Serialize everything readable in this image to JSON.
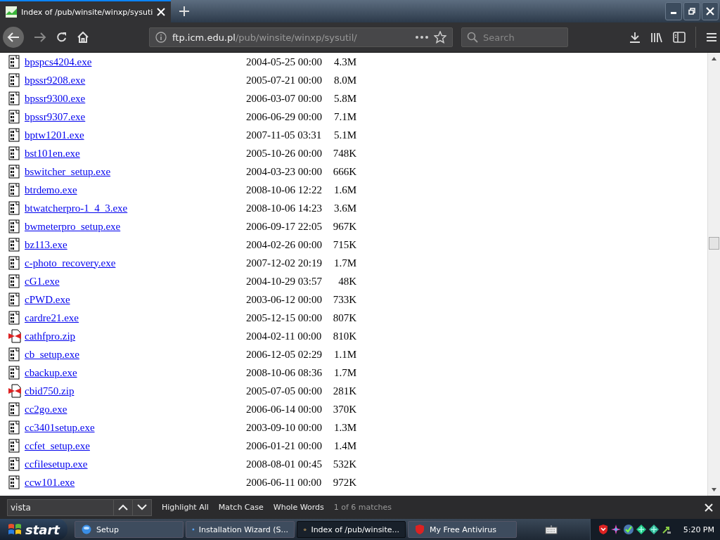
{
  "browser": {
    "tab": {
      "title": "Index of /pub/winsite/winxp/sysuti",
      "selected": true
    },
    "address": {
      "host": "ftp.icm.edu.pl",
      "path": "/pub/winsite/winxp/sysutil/"
    },
    "search": {
      "placeholder": "Search"
    }
  },
  "listing": [
    {
      "kind": "exe",
      "name": "bpspcs4204.exe",
      "date": "2004-05-25 00:00",
      "size": "4.3M"
    },
    {
      "kind": "exe",
      "name": "bpssr9208.exe",
      "date": "2005-07-21 00:00",
      "size": "8.0M"
    },
    {
      "kind": "exe",
      "name": "bpssr9300.exe",
      "date": "2006-03-07 00:00",
      "size": "5.8M"
    },
    {
      "kind": "exe",
      "name": "bpssr9307.exe",
      "date": "2006-06-29 00:00",
      "size": "7.1M"
    },
    {
      "kind": "exe",
      "name": "bptw1201.exe",
      "date": "2007-11-05 03:31",
      "size": "5.1M"
    },
    {
      "kind": "exe",
      "name": "bst101en.exe",
      "date": "2005-10-26 00:00",
      "size": "748K"
    },
    {
      "kind": "exe",
      "name": "bswitcher_setup.exe",
      "date": "2004-03-23 00:00",
      "size": "666K"
    },
    {
      "kind": "exe",
      "name": "btrdemo.exe",
      "date": "2008-10-06 12:22",
      "size": "1.6M"
    },
    {
      "kind": "exe",
      "name": "btwatcherpro-1_4_3.exe",
      "date": "2008-10-06 14:23",
      "size": "3.6M"
    },
    {
      "kind": "exe",
      "name": "bwmeterpro_setup.exe",
      "date": "2006-09-17 22:05",
      "size": "967K"
    },
    {
      "kind": "exe",
      "name": "bz113.exe",
      "date": "2004-02-26 00:00",
      "size": "715K"
    },
    {
      "kind": "exe",
      "name": "c-photo_recovery.exe",
      "date": "2007-12-02 20:19",
      "size": "1.7M"
    },
    {
      "kind": "exe",
      "name": "cG1.exe",
      "date": "2004-10-29 03:57",
      "size": "48K"
    },
    {
      "kind": "exe",
      "name": "cPWD.exe",
      "date": "2003-06-12 00:00",
      "size": "733K"
    },
    {
      "kind": "exe",
      "name": "cardre21.exe",
      "date": "2005-12-15 00:00",
      "size": "807K"
    },
    {
      "kind": "zip",
      "name": "cathfpro.zip",
      "date": "2004-02-11 00:00",
      "size": "810K"
    },
    {
      "kind": "exe",
      "name": "cb_setup.exe",
      "date": "2006-12-05 02:29",
      "size": "1.1M"
    },
    {
      "kind": "exe",
      "name": "cbackup.exe",
      "date": "2008-10-06 08:36",
      "size": "1.7M"
    },
    {
      "kind": "zip",
      "name": "cbid750.zip",
      "date": "2005-07-05 00:00",
      "size": "281K"
    },
    {
      "kind": "exe",
      "name": "cc2go.exe",
      "date": "2006-06-14 00:00",
      "size": "370K"
    },
    {
      "kind": "exe",
      "name": "cc3401setup.exe",
      "date": "2003-09-10 00:00",
      "size": "1.3M"
    },
    {
      "kind": "exe",
      "name": "ccfet_setup.exe",
      "date": "2006-01-21 00:00",
      "size": "1.4M"
    },
    {
      "kind": "exe",
      "name": "ccfilesetup.exe",
      "date": "2008-08-01 00:45",
      "size": "532K"
    },
    {
      "kind": "exe",
      "name": "ccw101.exe",
      "date": "2006-06-11 00:00",
      "size": "972K"
    }
  ],
  "find_bar": {
    "value": "vista",
    "options": [
      "Highlight All",
      "Match Case",
      "Whole Words"
    ],
    "status": "1 of 6 matches"
  },
  "taskbar": {
    "start": "start",
    "tasks": [
      {
        "label": "Setup",
        "selected": false
      },
      {
        "label": "Installation Wizard (S...",
        "selected": false
      },
      {
        "label": "Index of /pub/winsite...",
        "selected": true
      },
      {
        "label": "My Free Antivirus",
        "selected": false
      }
    ],
    "clock": "5:20 PM"
  }
}
